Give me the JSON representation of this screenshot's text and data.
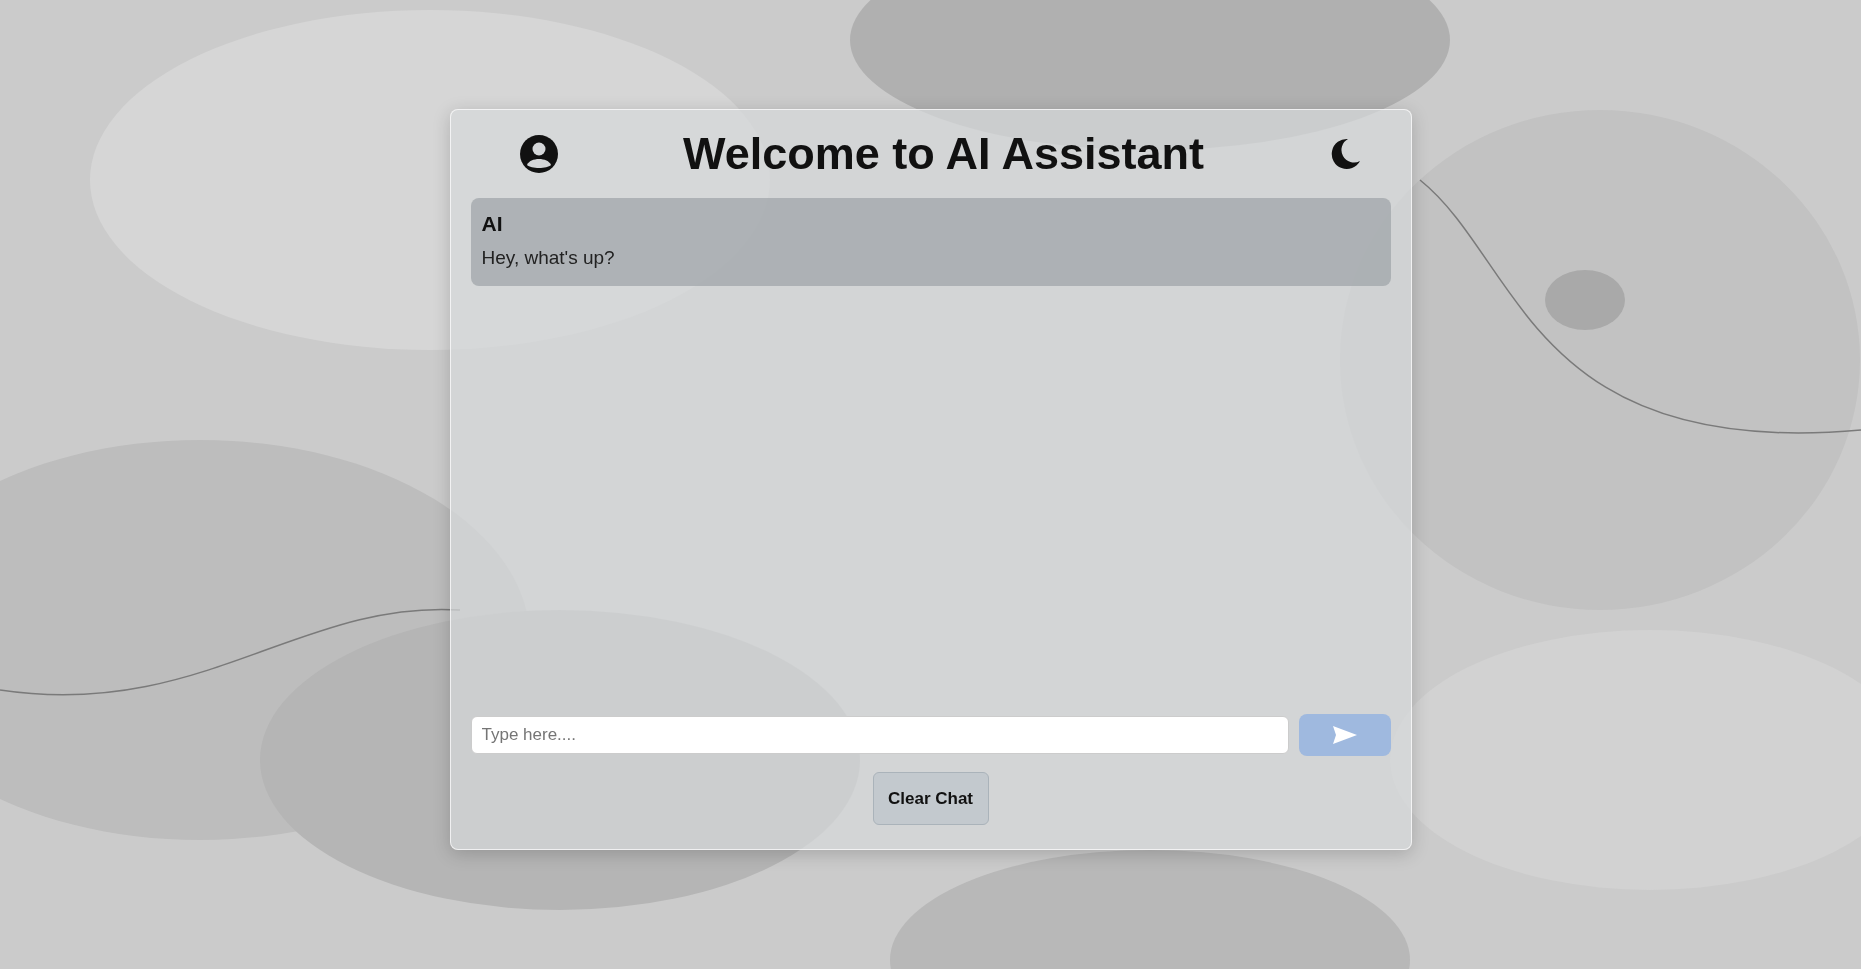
{
  "header": {
    "title": "Welcome to AI Assistant"
  },
  "messages": [
    {
      "sender": "AI",
      "text": "Hey, what's up?"
    }
  ],
  "composer": {
    "placeholder": "Type here...."
  },
  "clear_button": {
    "label": "Clear Chat"
  }
}
